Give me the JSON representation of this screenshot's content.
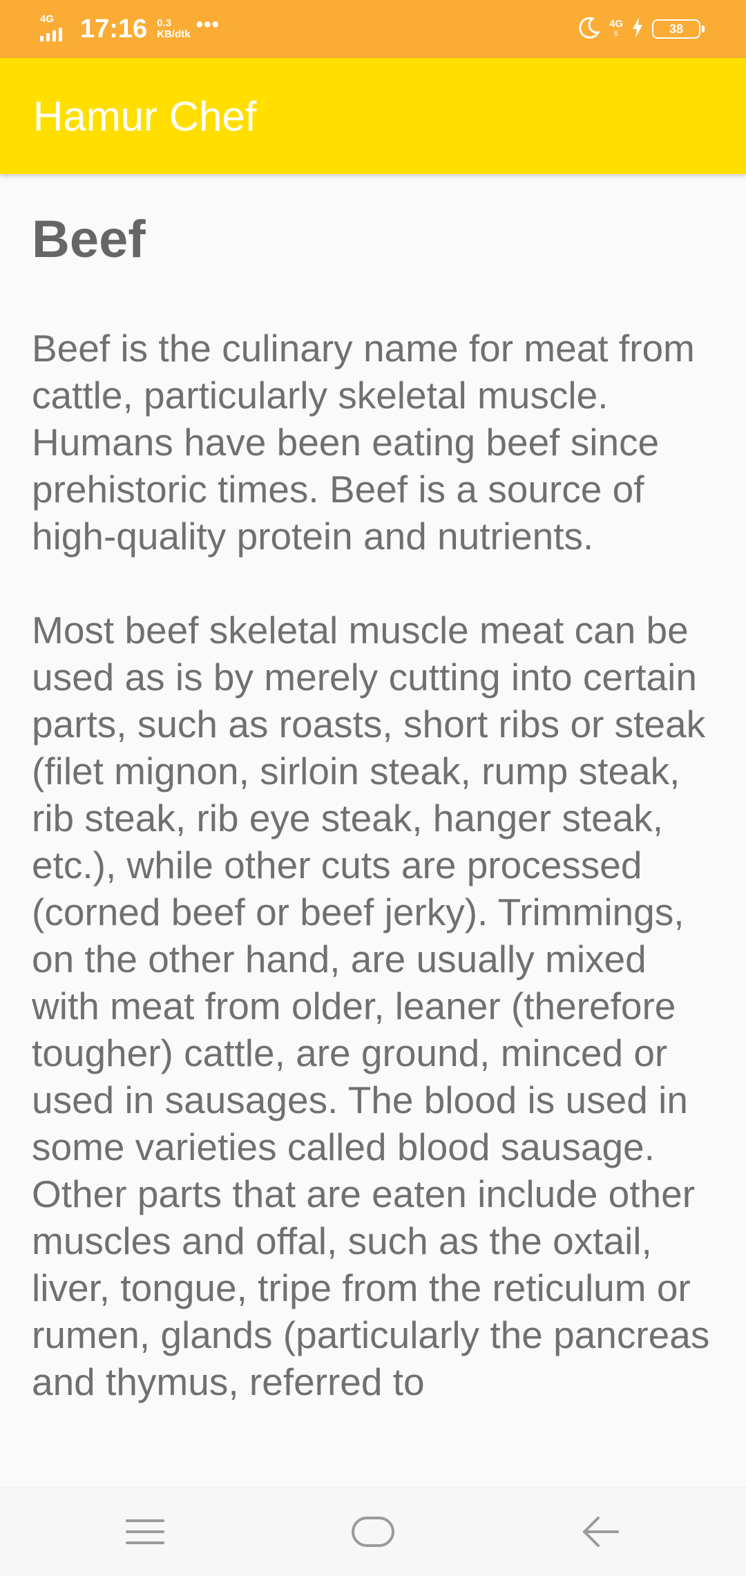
{
  "status_bar": {
    "network_left": "4G",
    "time": "17:16",
    "speed_value": "0.3",
    "speed_unit": "KB/dtk",
    "more": "•••",
    "network_right": "4G",
    "battery_level": "38"
  },
  "app_bar": {
    "title": "Hamur Chef"
  },
  "article": {
    "title": "Beef",
    "paragraphs": [
      "Beef is the culinary name for meat from cattle, particularly skeletal muscle. Humans have been eating beef since prehistoric times. Beef is a source of high-quality protein and nutrients.",
      "Most beef skeletal muscle meat can be used as is by merely cutting into certain parts, such as roasts, short ribs or steak (filet mignon, sirloin steak, rump steak, rib steak, rib eye steak, hanger steak, etc.), while other cuts are processed (corned beef or beef jerky). Trimmings, on the other hand, are usually mixed with meat from older, leaner (therefore tougher) cattle, are ground, minced or used in sausages. The blood is used in some varieties called blood sausage. Other parts that are eaten include other muscles and offal, such as the oxtail, liver, tongue, tripe from the reticulum or rumen, glands (particularly the pancreas and thymus, referred to"
    ]
  },
  "nav_bar": {
    "buttons": [
      "menu-icon",
      "home-icon",
      "back-icon"
    ]
  },
  "colors": {
    "status_bar": "#fbac35",
    "app_bar": "#ffde00",
    "background": "#fafafa",
    "text": "#707070",
    "title_text": "#666666"
  }
}
